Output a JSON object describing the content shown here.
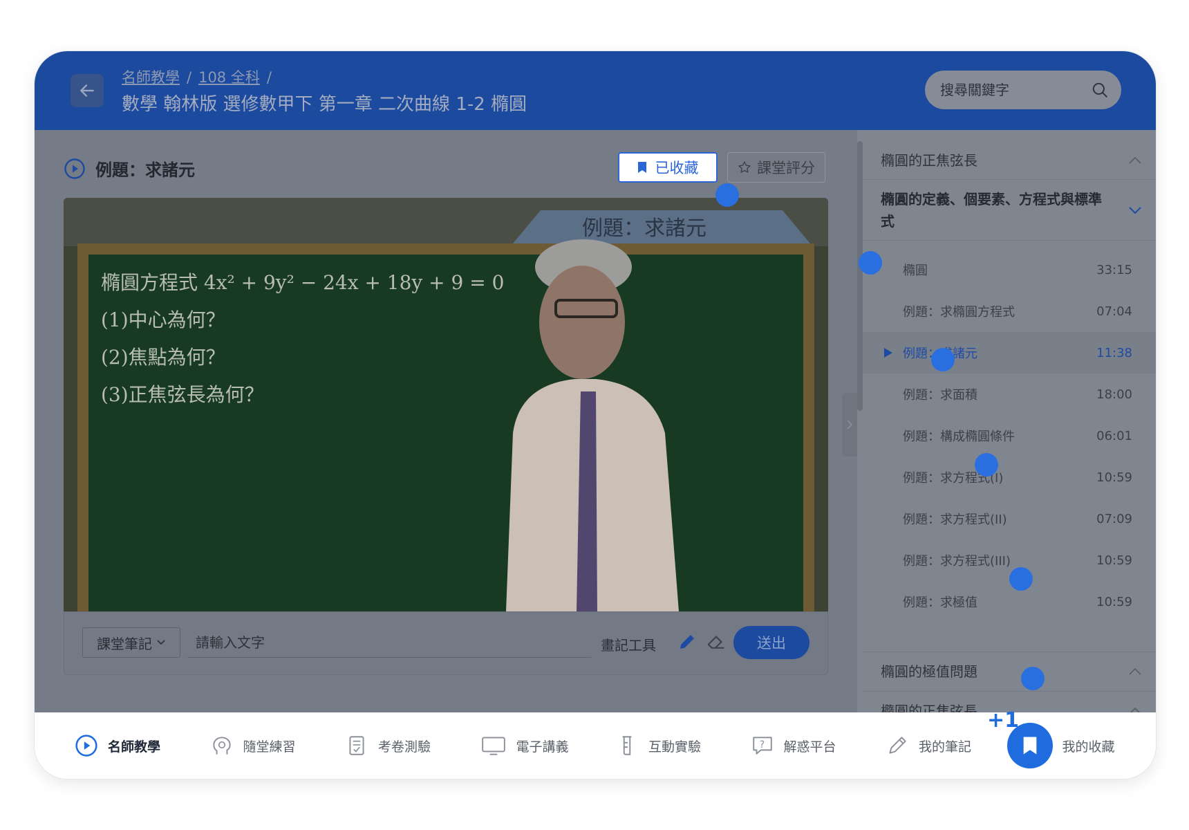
{
  "header": {
    "breadcrumb": [
      "名師教學",
      "108 全科"
    ],
    "breadcrumb_sep": "/",
    "course_title": "數學 翰林版 選修數甲下 第一章 二次曲線 1-2 橢圓",
    "search_placeholder": "搜尋關鍵字"
  },
  "lesson": {
    "title": "例題：求諸元",
    "fav_label": "已收藏",
    "rate_label": "課堂評分"
  },
  "video": {
    "banner": "例題：求諸元",
    "board_lines": [
      "橢圓方程式 4x² + 9y² − 24x + 18y + 9 = 0",
      "(1)中心為何？",
      "(2)焦點為何？",
      "(3)正焦弦長為何？"
    ]
  },
  "notes": {
    "select_label": "課堂筆記",
    "input_placeholder": "請輸入文字",
    "draw_tools_label": "畫記工具",
    "send_label": "送出"
  },
  "sidebar": {
    "sections": [
      {
        "title": "橢圓的正焦弦長",
        "state": "collapsed"
      },
      {
        "title": "橢圓的定義、個要素、方程式與標準式",
        "state": "expanded"
      },
      {
        "title": "橢圓的極值問題",
        "state": "collapsed"
      },
      {
        "title": "橢圓的正焦弦長",
        "state": "collapsed"
      }
    ],
    "items": [
      {
        "label": "橢圓",
        "duration": "33:15"
      },
      {
        "label": "例題：求橢圓方程式",
        "duration": "07:04"
      },
      {
        "label": "例題：求諸元",
        "duration": "11:38",
        "active": true
      },
      {
        "label": "例題：求面積",
        "duration": "18:00"
      },
      {
        "label": "例題：構成橢圓條件",
        "duration": "06:01"
      },
      {
        "label": "例題：求方程式(I)",
        "duration": "10:59"
      },
      {
        "label": "例題：求方程式(II)",
        "duration": "07:09"
      },
      {
        "label": "例題：求方程式(III)",
        "duration": "10:59"
      },
      {
        "label": "例題：求極值",
        "duration": "10:59"
      }
    ]
  },
  "bottom_nav": [
    {
      "label": "名師教學",
      "icon": "play-circle-icon",
      "active": true
    },
    {
      "label": "隨堂練習",
      "icon": "brain-icon"
    },
    {
      "label": "考卷測驗",
      "icon": "test-paper-icon"
    },
    {
      "label": "電子講義",
      "icon": "monitor-icon"
    },
    {
      "label": "互動實驗",
      "icon": "beaker-icon"
    },
    {
      "label": "解惑平台",
      "icon": "question-bubble-icon"
    },
    {
      "label": "我的筆記",
      "icon": "pencil-icon"
    },
    {
      "label": "我的收藏",
      "icon": "bookmark-icon",
      "highlighted": true
    }
  ],
  "plus_one": "+1",
  "colors": {
    "brand": "#1c4a9f",
    "accent": "#1f6cdf"
  }
}
